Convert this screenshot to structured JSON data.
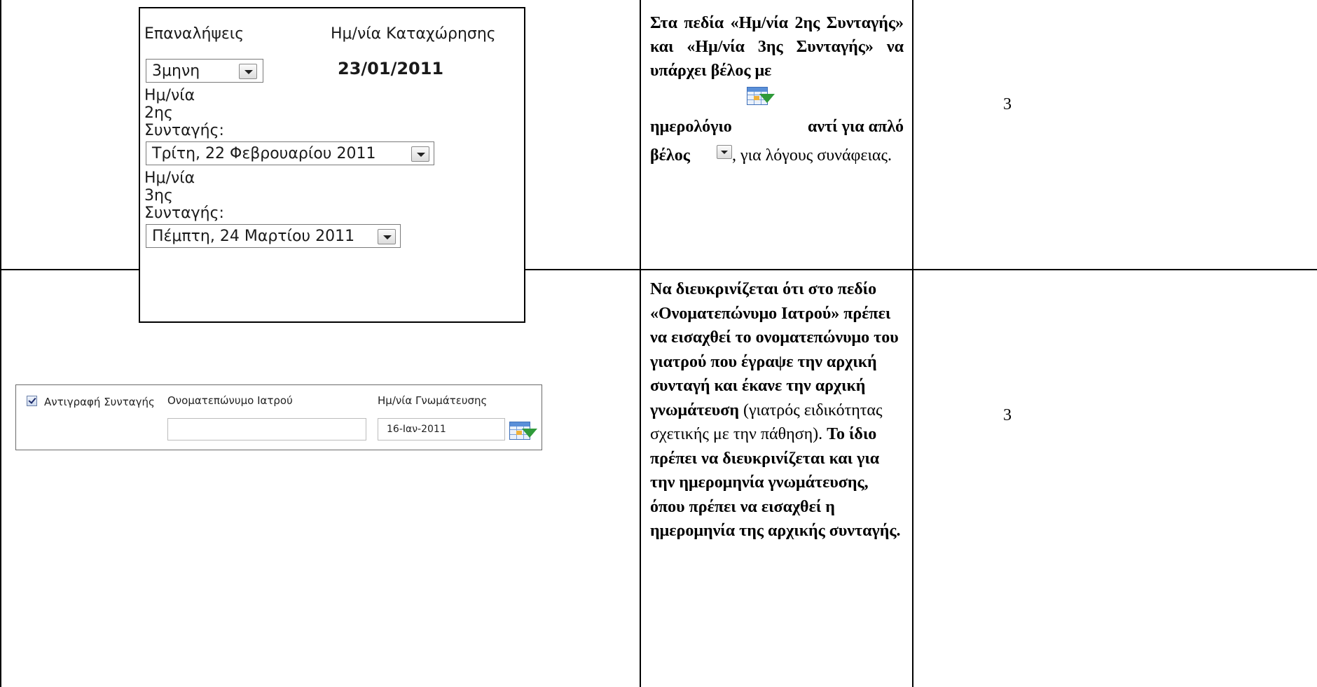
{
  "row1": {
    "panel": {
      "repeats_label": "Επαναλήψεις",
      "registration_date_label": "Ημ/νία Καταχώρησης",
      "repeats_value": "3μηνη",
      "registration_date_value": "23/01/2011",
      "second_rx_label_l1": "Ημ/νία",
      "second_rx_label_l2": "2ης",
      "second_rx_label_l3": "Συνταγής:",
      "second_rx_value": "Τρίτη, 22 Φεβρουαρίου 2011",
      "third_rx_label_l1": "Ημ/νία",
      "third_rx_label_l2": "3ης",
      "third_rx_label_l3": "Συνταγής:",
      "third_rx_value": "Πέμπτη, 24 Μαρτίου 2011"
    },
    "text": {
      "t1": "Στα πεδία «Ημ/νία 2ης Συνταγής» και «Ημ/νία 3ης Συνταγής» να υπάρχει βέλος με",
      "t2": "ημερολόγιο",
      "t3": "αντί για απλό",
      "t4": "βέλος",
      "t5": ", για λόγους συνάφειας."
    },
    "number": "3"
  },
  "row2": {
    "form": {
      "copy_label": "Αντιγραφή Συνταγής",
      "doctor_label": "Ονοματεπώνυμο Ιατρού",
      "date_label": "Ημ/νία Γνωμάτευσης",
      "doctor_value": "",
      "date_value": "16-Ιαν-2011"
    },
    "text": {
      "b1": "Να διευκρινίζεται ότι στο πεδίο «Ονοματεπώνυμο Ιατρού» πρέπει να εισαχθεί το ονοματεπώνυμο του γιατρού που έγραψε την αρχική συνταγή και έκανε την αρχική γνωμάτευση",
      "n1": " (γιατρός ειδικότητας σχετικής με την πάθηση). ",
      "b2": "Το ίδιο πρέπει να διευκρινίζεται και για την ημερομηνία γνωμάτευσης, όπου πρέπει να εισαχθεί η ημερομηνία της αρχικής συνταγής."
    },
    "number": "3"
  },
  "icons": {
    "calendar": "calendar-dropdown-icon",
    "dropdown": "dropdown-arrow-icon",
    "checkbox": "checkbox-checked-icon"
  },
  "colors": {
    "calendar_blue": "#3e6fb8",
    "calendar_arrow_green": "#2f9a3a"
  }
}
